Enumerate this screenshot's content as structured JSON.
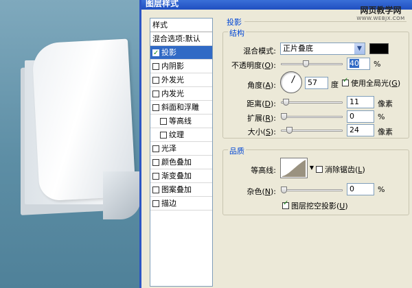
{
  "dialog": {
    "title": "图层样式"
  },
  "watermark": {
    "name": "网页教学网",
    "url": "WWW.WEBJX.COM"
  },
  "style_list": {
    "header": "样式",
    "items": [
      {
        "label": "混合选项:默认",
        "checkbox": false,
        "checked": false,
        "sub": false,
        "selected": false
      },
      {
        "label": "投影",
        "checkbox": true,
        "checked": true,
        "sub": false,
        "selected": true
      },
      {
        "label": "内阴影",
        "checkbox": true,
        "checked": false,
        "sub": false,
        "selected": false
      },
      {
        "label": "外发光",
        "checkbox": true,
        "checked": false,
        "sub": false,
        "selected": false
      },
      {
        "label": "内发光",
        "checkbox": true,
        "checked": false,
        "sub": false,
        "selected": false
      },
      {
        "label": "斜面和浮雕",
        "checkbox": true,
        "checked": false,
        "sub": false,
        "selected": false
      },
      {
        "label": "等高线",
        "checkbox": true,
        "checked": false,
        "sub": true,
        "selected": false
      },
      {
        "label": "纹理",
        "checkbox": true,
        "checked": false,
        "sub": true,
        "selected": false
      },
      {
        "label": "光泽",
        "checkbox": true,
        "checked": false,
        "sub": false,
        "selected": false
      },
      {
        "label": "颜色叠加",
        "checkbox": true,
        "checked": false,
        "sub": false,
        "selected": false
      },
      {
        "label": "渐变叠加",
        "checkbox": true,
        "checked": false,
        "sub": false,
        "selected": false
      },
      {
        "label": "图案叠加",
        "checkbox": true,
        "checked": false,
        "sub": false,
        "selected": false
      },
      {
        "label": "描边",
        "checkbox": true,
        "checked": false,
        "sub": false,
        "selected": false
      }
    ]
  },
  "drop_shadow": {
    "section_title": "投影",
    "structure_title": "结构",
    "blend_mode": {
      "label": "混合模式:",
      "value": "正片叠底",
      "color": "#000000"
    },
    "opacity": {
      "label_pre": "不透明度(",
      "key": "O",
      "label_post": "):",
      "value": "40",
      "unit": "%",
      "slider": 0.4
    },
    "angle": {
      "label_pre": "角度(",
      "key": "A",
      "label_post": "):",
      "value": "57",
      "unit": "度",
      "global_light": {
        "label_pre": "使用全局光(",
        "key": "G",
        "label_post": ")",
        "checked": true
      }
    },
    "distance": {
      "label_pre": "距离(",
      "key": "D",
      "label_post": "):",
      "value": "11",
      "unit": "像素",
      "slider": 0.04
    },
    "spread": {
      "label_pre": "扩展(",
      "key": "R",
      "label_post": "):",
      "value": "0",
      "unit": "%",
      "slider": 0.0
    },
    "size": {
      "label_pre": "大小(",
      "key": "S",
      "label_post": "):",
      "value": "24",
      "unit": "像素",
      "slider": 0.1
    }
  },
  "quality": {
    "title": "品质",
    "contour": {
      "label": "等高线:"
    },
    "anti_alias": {
      "label_pre": "消除锯齿(",
      "key": "L",
      "label_post": ")",
      "checked": false
    },
    "noise": {
      "label_pre": "杂色(",
      "key": "N",
      "label_post": "):",
      "value": "0",
      "unit": "%",
      "slider": 0.0
    },
    "knockout": {
      "label_pre": "图层挖空投影(",
      "key": "U",
      "label_post": ")",
      "checked": true
    }
  }
}
